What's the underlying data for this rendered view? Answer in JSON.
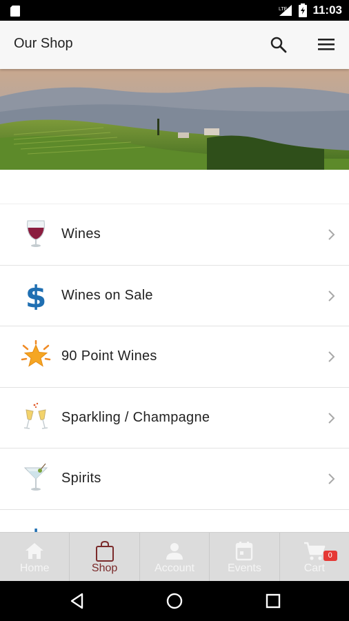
{
  "status_bar": {
    "time": "11:03",
    "network_label": "LTE"
  },
  "header": {
    "title": "Our Shop"
  },
  "categories": [
    {
      "label": "Wines",
      "icon": "wine-glass-icon"
    },
    {
      "label": "Wines on Sale",
      "icon": "dollar-sign-icon"
    },
    {
      "label": "90 Point Wines",
      "icon": "star-burst-icon"
    },
    {
      "label": "Sparkling / Champagne",
      "icon": "champagne-glasses-icon"
    },
    {
      "label": "Spirits",
      "icon": "cocktail-icon"
    },
    {
      "label": "",
      "icon": "dollar-sign-icon"
    }
  ],
  "bottom_nav": [
    {
      "label": "Home",
      "icon": "home-icon",
      "active": false
    },
    {
      "label": "Shop",
      "icon": "shopping-bag-icon",
      "active": true
    },
    {
      "label": "Account",
      "icon": "person-icon",
      "active": false
    },
    {
      "label": "Events",
      "icon": "calendar-icon",
      "active": false
    },
    {
      "label": "Cart",
      "icon": "cart-icon",
      "active": false,
      "badge": "0"
    }
  ],
  "colors": {
    "active_nav": "#7a2a2a",
    "badge": "#e53935",
    "dollar_blue": "#1f6fb2",
    "wine_red": "#8b1d3f",
    "star_orange": "#f5a623"
  }
}
